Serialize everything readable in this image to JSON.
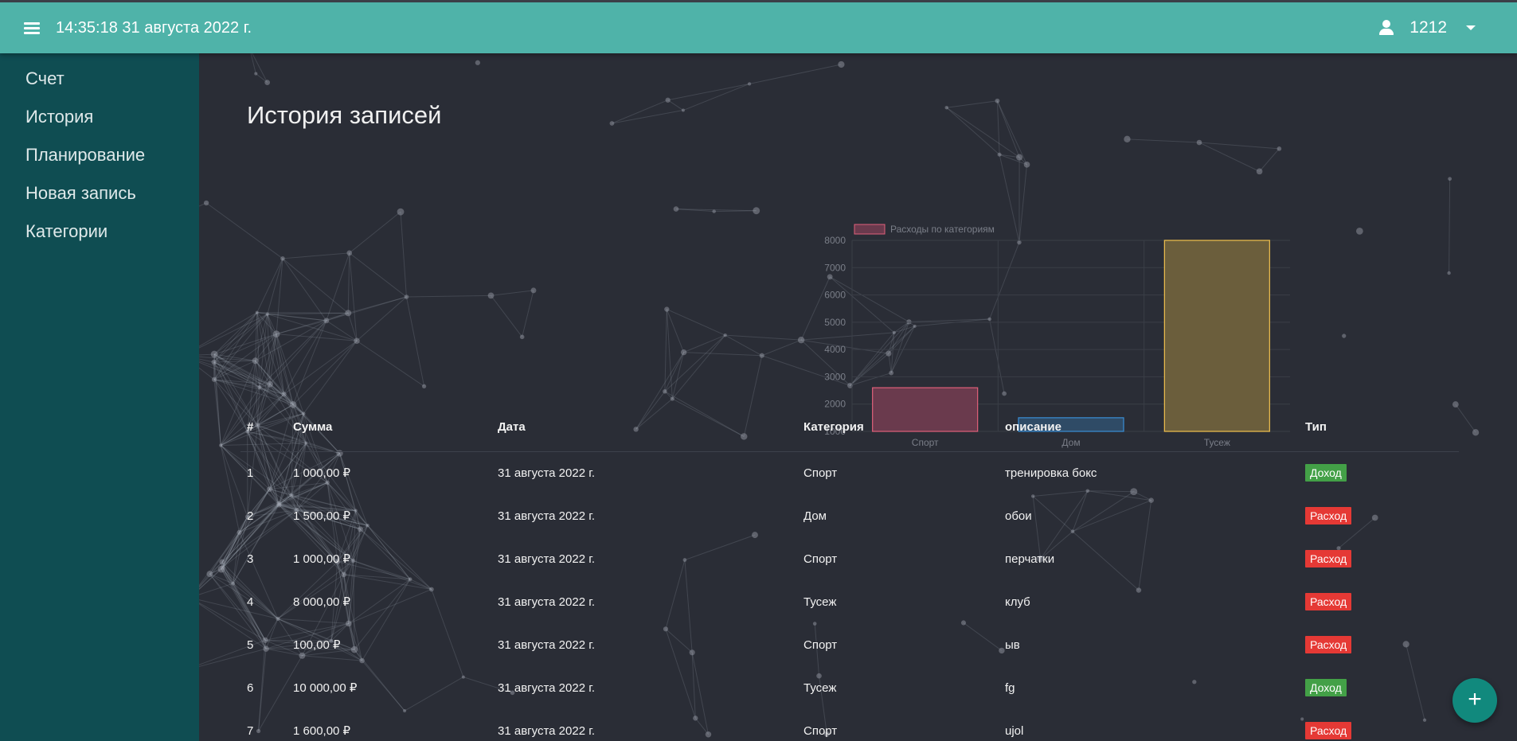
{
  "header": {
    "datetime": "14:35:18 31 августа 2022 г.",
    "user_name": "1212"
  },
  "sidebar": {
    "items": [
      {
        "label": "Счет"
      },
      {
        "label": "История"
      },
      {
        "label": "Планирование"
      },
      {
        "label": "Новая запись"
      },
      {
        "label": "Категории"
      }
    ]
  },
  "page": {
    "title": "История записей"
  },
  "chart_data": {
    "type": "bar",
    "categories": [
      "Спорт",
      "Дом",
      "Тусеж"
    ],
    "series": [
      {
        "name": "Расходы по категориям",
        "values": [
          2600,
          1500,
          8000
        ]
      }
    ],
    "ylim": [
      1000,
      8000
    ],
    "yticks": [
      1000,
      2000,
      3000,
      4000,
      5000,
      6000,
      7000,
      8000
    ],
    "legend_position": "top",
    "colors": {
      "fills": [
        "#6a3a4d",
        "#2f4b66",
        "#6b5e3c"
      ],
      "borders": [
        "#e0607a",
        "#3a8ed6",
        "#f2c14e"
      ]
    }
  },
  "table": {
    "headers": [
      "#",
      "Сумма",
      "Дата",
      "Категория",
      "описание",
      "Тип"
    ],
    "rows": [
      {
        "num": "1",
        "amount": "1 000,00 ₽",
        "date": "31 августа 2022 г.",
        "category": "Спорт",
        "description": "тренировка бокс",
        "type": "Доход",
        "kind": "income"
      },
      {
        "num": "2",
        "amount": "1 500,00 ₽",
        "date": "31 августа 2022 г.",
        "category": "Дом",
        "description": "обои",
        "type": "Расход",
        "kind": "expense"
      },
      {
        "num": "3",
        "amount": "1 000,00 ₽",
        "date": "31 августа 2022 г.",
        "category": "Спорт",
        "description": "перчатки",
        "type": "Расход",
        "kind": "expense"
      },
      {
        "num": "4",
        "amount": "8 000,00 ₽",
        "date": "31 августа 2022 г.",
        "category": "Тусеж",
        "description": "клуб",
        "type": "Расход",
        "kind": "expense"
      },
      {
        "num": "5",
        "amount": "100,00 ₽",
        "date": "31 августа 2022 г.",
        "category": "Спорт",
        "description": "ыв",
        "type": "Расход",
        "kind": "expense"
      },
      {
        "num": "6",
        "amount": "10 000,00 ₽",
        "date": "31 августа 2022 г.",
        "category": "Тусеж",
        "description": "fg",
        "type": "Доход",
        "kind": "income"
      },
      {
        "num": "7",
        "amount": "1 600,00 ₽",
        "date": "31 августа 2022 г.",
        "category": "Спорт",
        "description": "ujol",
        "type": "Расход",
        "kind": "expense"
      }
    ]
  },
  "fab": {
    "label": "+"
  },
  "colors": {
    "navbar": "#4fb3a9",
    "sidebar": "#0f4d52",
    "background": "#2a2d36",
    "income": "#43a047",
    "expense": "#e53935",
    "fab": "#11897d"
  }
}
